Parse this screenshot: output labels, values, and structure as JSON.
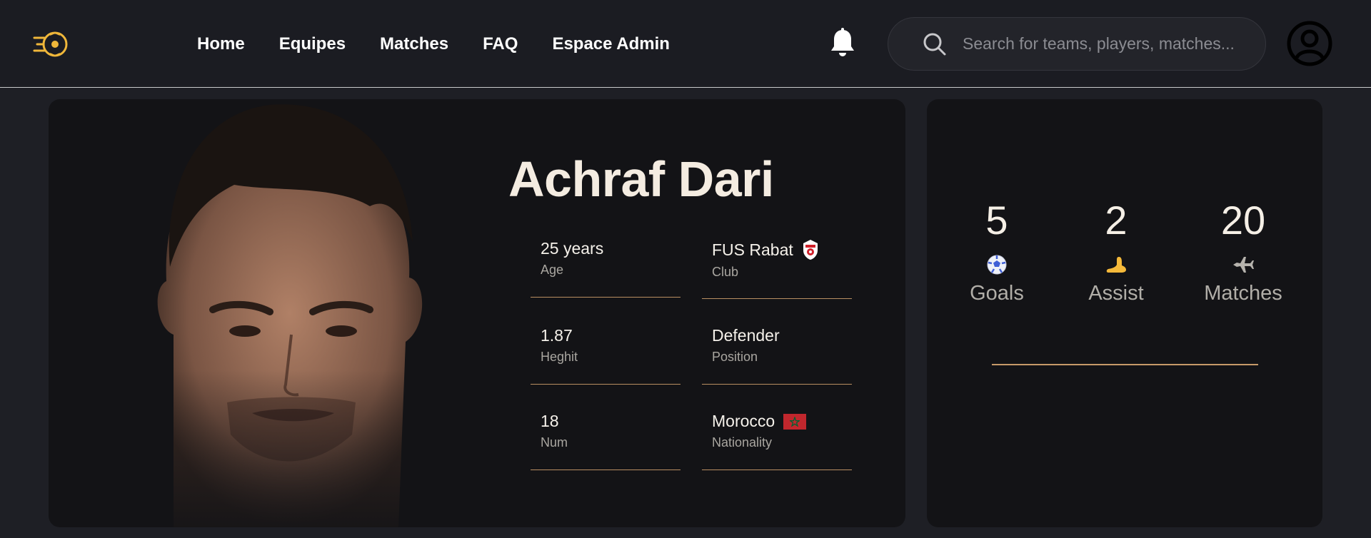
{
  "nav": {
    "items": [
      {
        "label": "Home"
      },
      {
        "label": "Equipes"
      },
      {
        "label": "Matches"
      },
      {
        "label": "FAQ"
      },
      {
        "label": "Espace Admin"
      }
    ]
  },
  "search": {
    "placeholder": "Search for teams, players, matches...",
    "value": ""
  },
  "player": {
    "name": "Achraf Dari",
    "age": {
      "value": "25 years",
      "label": "Age"
    },
    "club": {
      "value": "FUS Rabat",
      "label": "Club"
    },
    "height": {
      "value": "1.87",
      "label": "Heghit"
    },
    "position": {
      "value": "Defender",
      "label": "Position"
    },
    "number": {
      "value": "18",
      "label": "Num"
    },
    "nationality": {
      "value": "Morocco",
      "label": "Nationality"
    }
  },
  "stats": {
    "goals": {
      "value": "5",
      "label": "Goals"
    },
    "assist": {
      "value": "2",
      "label": "Assist"
    },
    "matches": {
      "value": "20",
      "label": "Matches"
    }
  },
  "icons": {
    "logo": "soccer-ball-speed-icon",
    "bell": "bell-icon",
    "search": "search-icon",
    "account": "user-circle-icon",
    "goals": "soccer-ball-icon",
    "assist": "foot-icon",
    "matches": "airplane-icon"
  },
  "colors": {
    "background": "#1e1f25",
    "card": "#131316",
    "accent": "#f0b73a",
    "divider": "#b98f62",
    "text": "#f3ece2"
  }
}
